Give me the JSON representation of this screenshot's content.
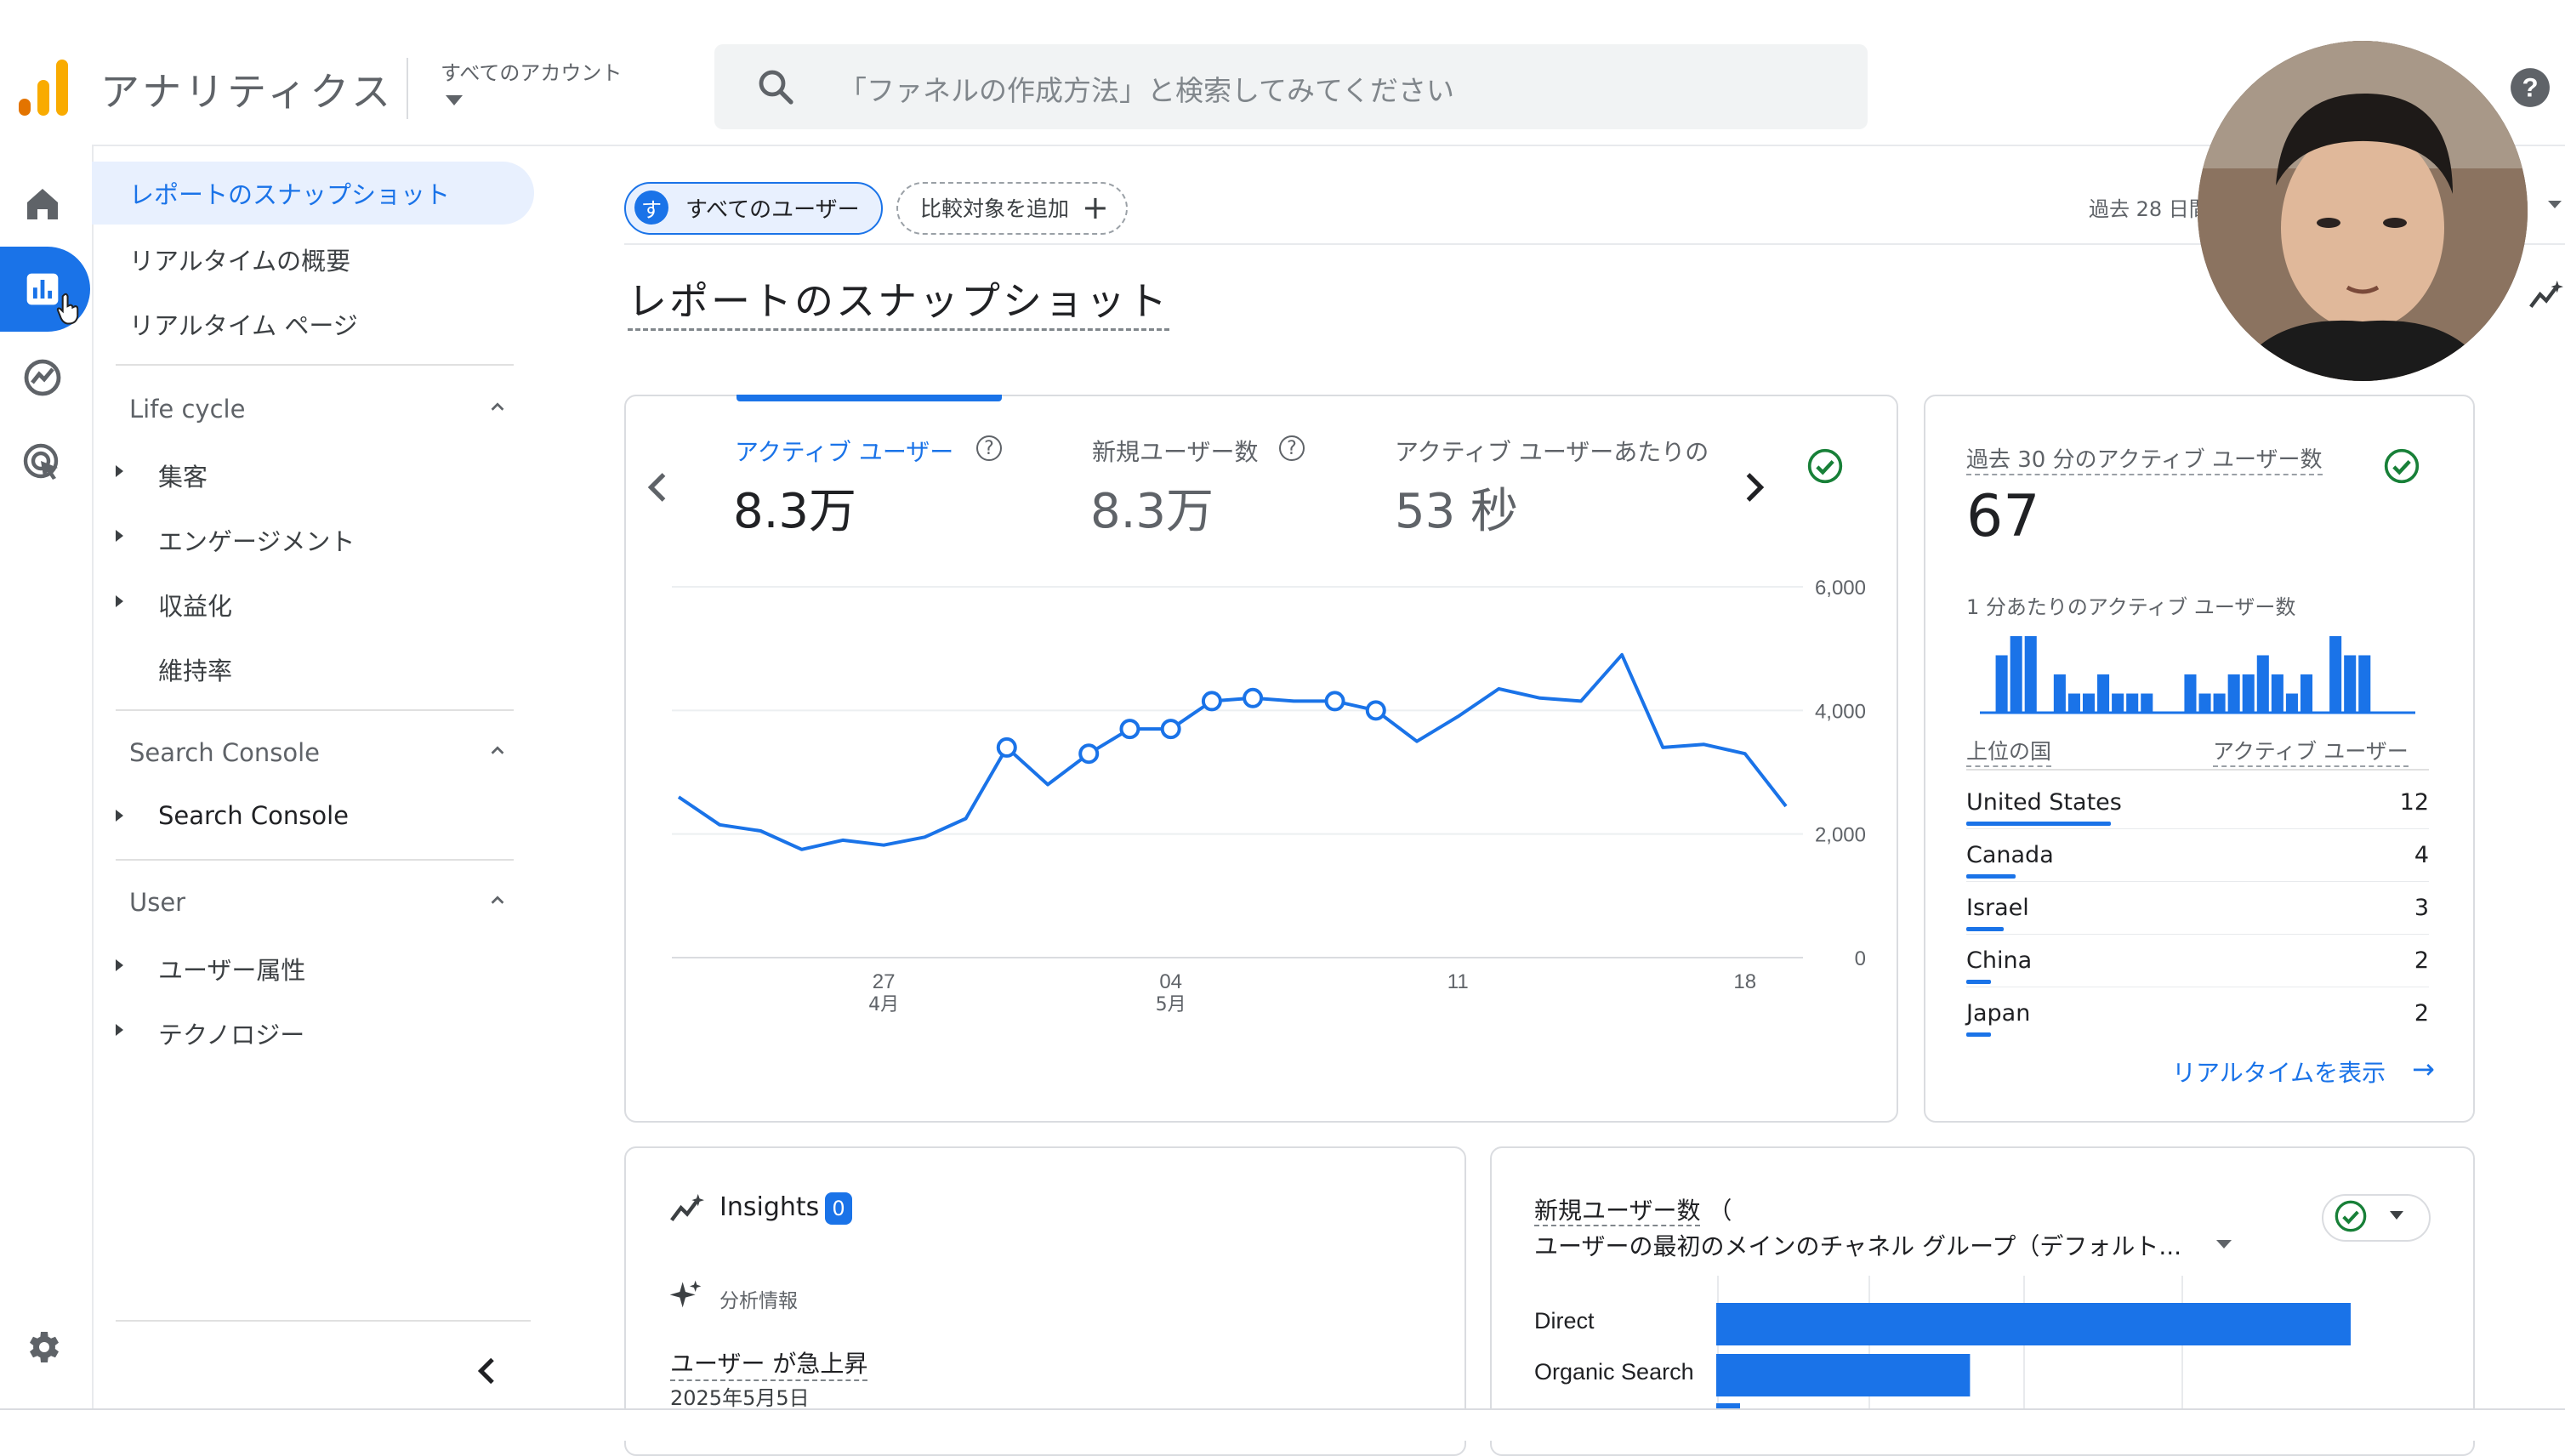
{
  "app": {
    "title": "アナリティクス",
    "account_label": "すべてのアカウント",
    "search_placeholder": "「ファネルの作成方法」と検索してみてください"
  },
  "sidebar": {
    "items_top": [
      {
        "label": "レポートのスナップショット",
        "active": true
      },
      {
        "label": "リアルタイムの概要"
      },
      {
        "label": "リアルタイム ページ"
      }
    ],
    "sections": [
      {
        "title": "Life cycle",
        "items": [
          "集客",
          "エンゲージメント",
          "収益化",
          "維持率"
        ]
      },
      {
        "title": "Search Console",
        "items": [
          "Search Console"
        ]
      },
      {
        "title": "User",
        "items": [
          "ユーザー属性",
          "テクノロジー"
        ]
      }
    ]
  },
  "header": {
    "segment_avatar": "す",
    "segment_label": "すべてのユーザー",
    "compare_label": "比較対象を追加",
    "date_range": "過去 28 日間",
    "page_title": "レポートのスナップショット"
  },
  "metrics": [
    {
      "label": "アクティブ ユーザー",
      "value": "8.3万",
      "active": true
    },
    {
      "label": "新規ユーザー数",
      "value": "8.3万"
    },
    {
      "label": "アクティブ ユーザーあたりの",
      "value": "53 秒"
    }
  ],
  "chart_data": {
    "type": "line",
    "x_ticks": [
      {
        "day": "27",
        "month": "4月",
        "index": 5
      },
      {
        "day": "04",
        "month": "5月",
        "index": 12
      },
      {
        "day": "11",
        "month": "",
        "index": 19
      },
      {
        "day": "18",
        "month": "",
        "index": 26
      }
    ],
    "y_ticks": [
      "6,000",
      "4,000",
      "2,000",
      "0"
    ],
    "ylim": [
      0,
      6000
    ],
    "values": [
      2600,
      2150,
      2050,
      1750,
      1900,
      1820,
      1950,
      2250,
      3400,
      2800,
      3300,
      3700,
      3700,
      4150,
      4200,
      4150,
      4150,
      4000,
      3500,
      3900,
      4350,
      4200,
      4150,
      4900,
      3400,
      3450,
      3300,
      2450
    ],
    "markers": [
      8,
      10,
      11,
      12,
      13,
      14,
      16,
      17
    ]
  },
  "realtime": {
    "label": "過去 30 分のアクティブ ユーザー数",
    "value": "67",
    "sub_label": "1 分あたりのアクティブ ユーザー数",
    "per_minute": [
      0,
      3,
      4,
      4,
      0,
      2,
      1,
      1,
      2,
      1,
      1,
      1,
      0,
      0,
      2,
      1,
      1,
      2,
      2,
      3,
      2,
      1,
      2,
      0,
      4,
      3,
      3,
      0,
      0,
      0
    ],
    "col_country": "上位の国",
    "col_users": "アクティブ ユーザー",
    "countries": [
      {
        "name": "United States",
        "count": "12",
        "share": 1.0
      },
      {
        "name": "Canada",
        "count": "4",
        "share": 0.34
      },
      {
        "name": "Israel",
        "count": "3",
        "share": 0.26
      },
      {
        "name": "China",
        "count": "2",
        "share": 0.17
      },
      {
        "name": "Japan",
        "count": "2",
        "share": 0.17
      }
    ],
    "link": "リアルタイムを表示"
  },
  "insights": {
    "title": "Insights",
    "badge": "0",
    "sub": "分析情報",
    "item_title": "ユーザー が急上昇",
    "item_date": "2025年5月5日"
  },
  "channel": {
    "title_line1": "新規ユーザー数",
    "title_paren": "（",
    "title_line2": "ユーザーの最初のメインのチャネル グループ（デフォルト...",
    "bars": [
      {
        "label": "Direct",
        "share": 1.0
      },
      {
        "label": "Organic Search",
        "share": 0.4
      }
    ]
  },
  "colors": {
    "accent": "#1a73e8",
    "logo_orange": "#f9ab00",
    "logo_dark": "#e37400",
    "check_green": "#188038"
  }
}
